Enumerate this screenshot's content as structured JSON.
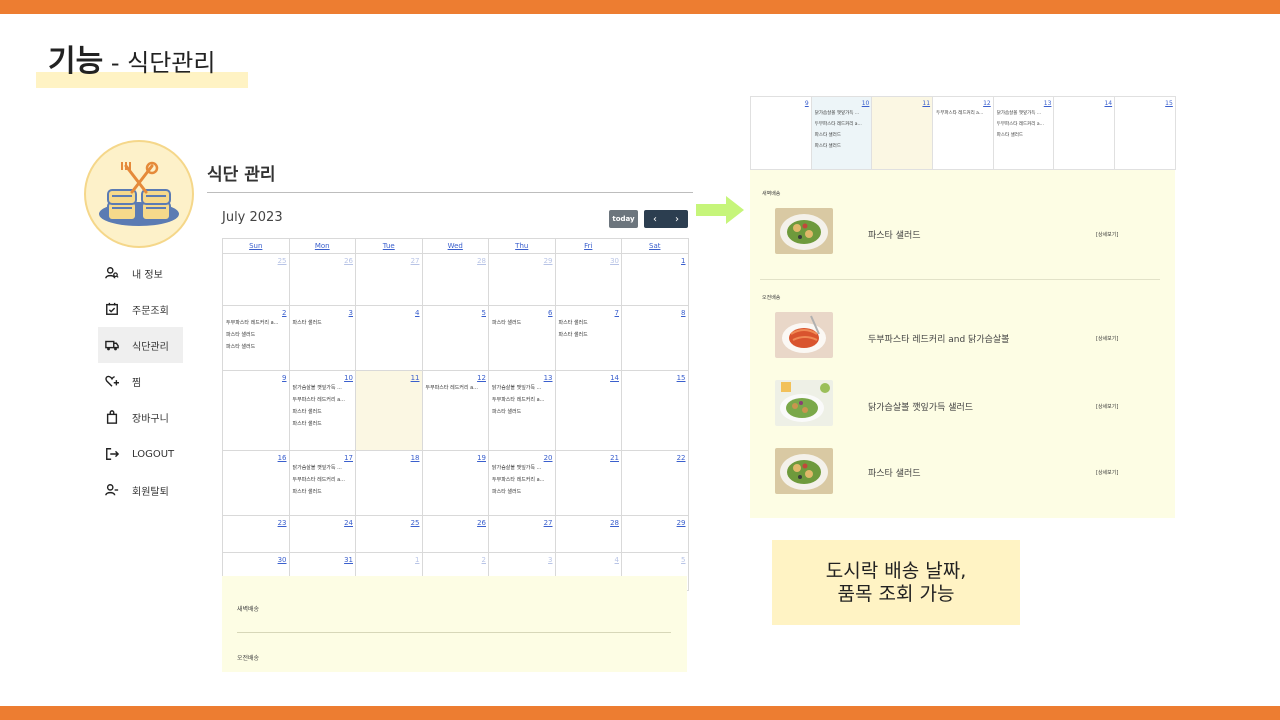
{
  "slide": {
    "title_bold": "기능",
    "title_rest": " - 식단관리"
  },
  "sidebar": {
    "items": [
      {
        "label": "내 정보",
        "icon": "user-search-icon"
      },
      {
        "label": "주문조회",
        "icon": "calendar-check-icon"
      },
      {
        "label": "식단관리",
        "icon": "truck-icon",
        "active": true
      },
      {
        "label": "찜",
        "icon": "heart-plus-icon"
      },
      {
        "label": "장바구니",
        "icon": "shopping-bag-icon"
      },
      {
        "label": "LOGOUT",
        "icon": "logout-icon"
      },
      {
        "label": "회원탈퇴",
        "icon": "user-minus-icon"
      }
    ]
  },
  "page": {
    "heading": "식단 관리"
  },
  "calendar": {
    "month": "July 2023",
    "today_label": "today",
    "prev_label": "‹",
    "next_label": "›",
    "weekdays": [
      "Sun",
      "Mon",
      "Tue",
      "Wed",
      "Thu",
      "Fri",
      "Sat"
    ],
    "weeks": [
      [
        {
          "d": "25",
          "m": true
        },
        {
          "d": "26",
          "m": true
        },
        {
          "d": "27",
          "m": true
        },
        {
          "d": "28",
          "m": true
        },
        {
          "d": "29",
          "m": true
        },
        {
          "d": "30",
          "m": true
        },
        {
          "d": "1"
        }
      ],
      [
        {
          "d": "2",
          "ev": [
            "두부파스타 레드커리 a...",
            "파스타 샐러드",
            "파스타 샐러드"
          ]
        },
        {
          "d": "3",
          "ev": [
            "파스타 샐러드"
          ]
        },
        {
          "d": "4"
        },
        {
          "d": "5"
        },
        {
          "d": "6",
          "ev": [
            "파스타 샐러드"
          ]
        },
        {
          "d": "7",
          "ev": [
            "파스타 샐러드",
            "파스타 샐러드"
          ]
        },
        {
          "d": "8"
        }
      ],
      [
        {
          "d": "9"
        },
        {
          "d": "10",
          "ev": [
            "닭가슴살볼 깻잎가득 ...",
            "두부파스타 레드커리 a...",
            "파스타 샐러드",
            "파스타 샐러드"
          ]
        },
        {
          "d": "11",
          "today": true
        },
        {
          "d": "12",
          "ev": [
            "두부파스타 레드커리 a..."
          ]
        },
        {
          "d": "13",
          "ev": [
            "닭가슴살볼 깻잎가득 ...",
            "두부파스타 레드커리 a...",
            "파스타 샐러드"
          ]
        },
        {
          "d": "14"
        },
        {
          "d": "15"
        }
      ],
      [
        {
          "d": "16"
        },
        {
          "d": "17",
          "ev": [
            "닭가슴살볼 깻잎가득 ...",
            "두부파스타 레드커리 a...",
            "파스타 샐러드"
          ]
        },
        {
          "d": "18"
        },
        {
          "d": "19"
        },
        {
          "d": "20",
          "ev": [
            "닭가슴살볼 깻잎가득 ...",
            "두부파스타 레드커리 a...",
            "파스타 샐러드"
          ]
        },
        {
          "d": "21"
        },
        {
          "d": "22"
        }
      ],
      [
        {
          "d": "23"
        },
        {
          "d": "24"
        },
        {
          "d": "25"
        },
        {
          "d": "26"
        },
        {
          "d": "27"
        },
        {
          "d": "28"
        },
        {
          "d": "29"
        }
      ],
      [
        {
          "d": "30"
        },
        {
          "d": "31"
        },
        {
          "d": "1",
          "m": true
        },
        {
          "d": "2",
          "m": true
        },
        {
          "d": "3",
          "m": true
        },
        {
          "d": "4",
          "m": true
        },
        {
          "d": "5",
          "m": true
        }
      ]
    ],
    "below": {
      "label1": "새벽배송",
      "label2": "오전배송"
    }
  },
  "zoom": {
    "week": [
      {
        "d": "9"
      },
      {
        "d": "10",
        "sel": true,
        "ev": [
          "닭가슴살볼 깻잎가득 ...",
          "두부파스타 레드커리 a...",
          "파스타 샐러드",
          "파스타 샐러드"
        ]
      },
      {
        "d": "11",
        "today": true
      },
      {
        "d": "12",
        "ev": [
          "두부파스타 레드커리 a..."
        ]
      },
      {
        "d": "13",
        "ev": [
          "닭가슴살볼 깻잎가득 ...",
          "두부파스타 레드커리 a...",
          "파스타 샐러드"
        ]
      },
      {
        "d": "14"
      },
      {
        "d": "15"
      }
    ],
    "detail": {
      "dawn_label": "새벽배송",
      "morning_label": "오전배송",
      "link_label": "[상세보기]",
      "items": [
        {
          "name": "파스타 샐러드",
          "group": "dawn",
          "image": "pasta-salad-image"
        },
        {
          "name": "두부파스타 레드커리 and 닭가슴살볼",
          "group": "morning",
          "image": "tofu-pasta-curry-image"
        },
        {
          "name": "닭가슴살볼 깻잎가득 샐러드",
          "group": "morning",
          "image": "chicken-ball-salad-image"
        },
        {
          "name": "파스타 샐러드",
          "group": "morning",
          "image": "pasta-salad-image"
        }
      ]
    }
  },
  "callout": {
    "line1": "도시락 배송 날짜,",
    "line2": "품목 조회 가능"
  },
  "colors": {
    "accent_bar": "#ed7d31",
    "highlight": "#fff3c4",
    "panel": "#fdfde4",
    "nav_button": "#2c3e50",
    "today_button": "#6c757d",
    "link": "#3a5fcd",
    "arrow": "#c6f57a"
  }
}
